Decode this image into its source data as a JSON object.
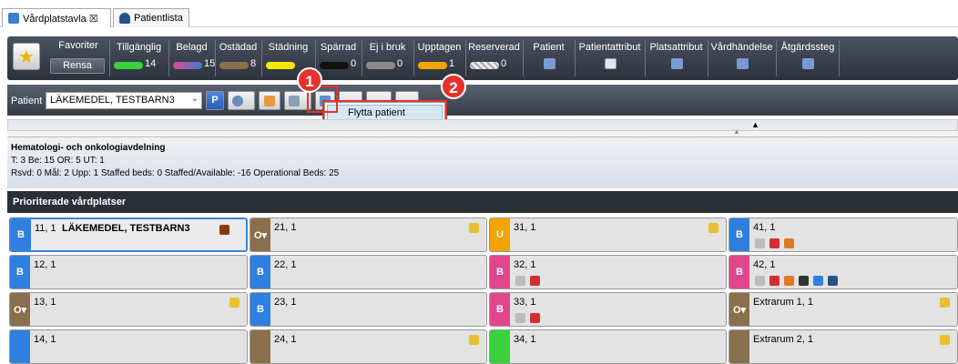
{
  "tabs": [
    {
      "label": "Vårdplatstavla ☒",
      "icon": "board-icon"
    },
    {
      "label": "Patientlista",
      "icon": "person-icon"
    }
  ],
  "filters": {
    "favoriter": "Favoriter",
    "rensa": "Rensa",
    "status": [
      {
        "label": "Tillgänglig",
        "count": "14",
        "color": "#3bd13b"
      },
      {
        "label": "Belagd",
        "count": "15",
        "color": "#e2458b"
      },
      {
        "label": "Ostädad",
        "count": "8",
        "color": "#8a6f4d"
      },
      {
        "label": "Städning",
        "count": "",
        "color": "#f5e800"
      },
      {
        "label": "Spärrad",
        "count": "0",
        "color": "#111111"
      },
      {
        "label": "Ej i bruk",
        "count": "0",
        "color": "#8a8a8a"
      },
      {
        "label": "Upptagen",
        "count": "1",
        "color": "#f5a300"
      },
      {
        "label": "Reserverad",
        "count": "0",
        "color": "#d8d8d8"
      }
    ],
    "attributes": [
      "Patient",
      "Patientattribut",
      "Platsattribut",
      "Vårdhändelse",
      "Åtgärdssteg"
    ]
  },
  "patient": {
    "label": "Patient",
    "selected": "LÄKEMEDEL, TESTBARN3"
  },
  "menu": {
    "item": "Flytta patient"
  },
  "callouts": [
    "1",
    "2"
  ],
  "department": {
    "name": "Hematologi- och onkologiavdelning",
    "line1": "T: 3 Be: 15 OR: 5 UT: 1",
    "line2": "Rsvd: 0 Mål: 2 Upp: 1 Staffed beds: 0 Staffed/Available: -16 Operational Beds: 25"
  },
  "section_title": "Prioriterade vårdplatser",
  "beds": [
    {
      "name": "11, 1",
      "status": "B",
      "color": "#2f7fe0",
      "patient": "LÄKEMEDEL, TESTBARN3"
    },
    {
      "name": "21, 1",
      "status": "O▾",
      "color": "#8a6f4d",
      "patient": ""
    },
    {
      "name": "31, 1",
      "status": "U",
      "color": "#f5a300",
      "patient": ""
    },
    {
      "name": "41, 1",
      "status": "B",
      "color": "#2f7fe0",
      "patient": ""
    },
    {
      "name": "12, 1",
      "status": "B",
      "color": "#2f7fe0",
      "patient": ""
    },
    {
      "name": "22, 1",
      "status": "B",
      "color": "#2f7fe0",
      "patient": ""
    },
    {
      "name": "32, 1",
      "status": "B",
      "color": "#e2458b",
      "patient": ""
    },
    {
      "name": "42, 1",
      "status": "B",
      "color": "#e2458b",
      "patient": ""
    },
    {
      "name": "13, 1",
      "status": "O▾",
      "color": "#8a6f4d",
      "patient": ""
    },
    {
      "name": "23, 1",
      "status": "B",
      "color": "#2f7fe0",
      "patient": ""
    },
    {
      "name": "33, 1",
      "status": "B",
      "color": "#e2458b",
      "patient": ""
    },
    {
      "name": "Extrarum 1, 1",
      "status": "O▾",
      "color": "#8a6f4d",
      "patient": ""
    },
    {
      "name": "14, 1",
      "status": "",
      "color": "#2f7fe0",
      "patient": ""
    },
    {
      "name": "24, 1",
      "status": "",
      "color": "#8a6f4d",
      "patient": ""
    },
    {
      "name": "34, 1",
      "status": "",
      "color": "#3bd13b",
      "patient": ""
    },
    {
      "name": "Extrarum 2, 1",
      "status": "",
      "color": "#8a6f4d",
      "patient": ""
    }
  ]
}
